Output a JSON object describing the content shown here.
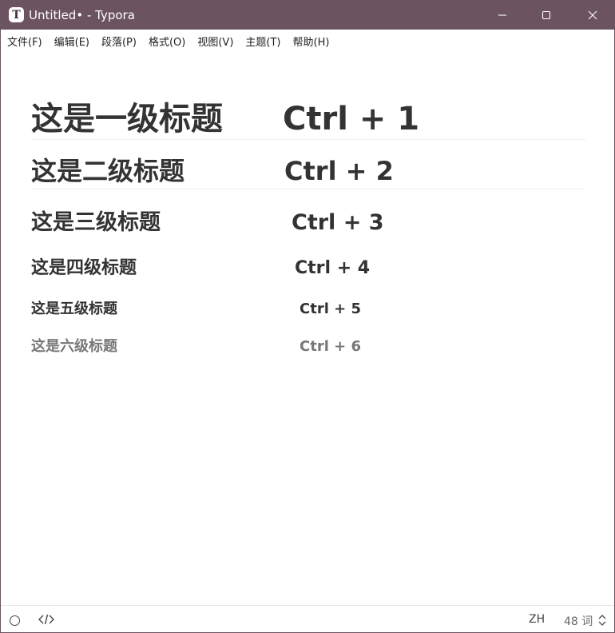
{
  "window": {
    "title": "Untitled• - Typora",
    "app_icon_letter": "T"
  },
  "menu": [
    {
      "label": "文件(F)"
    },
    {
      "label": "编辑(E)"
    },
    {
      "label": "段落(P)"
    },
    {
      "label": "格式(O)"
    },
    {
      "label": "视图(V)"
    },
    {
      "label": "主题(T)"
    },
    {
      "label": "帮助(H)"
    }
  ],
  "headings": [
    {
      "text": "这是一级标题",
      "shortcut": "Ctrl + 1"
    },
    {
      "text": "这是二级标题",
      "shortcut": "Ctrl + 2"
    },
    {
      "text": "这是三级标题",
      "shortcut": "Ctrl + 3"
    },
    {
      "text": "这是四级标题",
      "shortcut": "Ctrl + 4"
    },
    {
      "text": "这是五级标题",
      "shortcut": "Ctrl + 5"
    },
    {
      "text": "这是六级标题",
      "shortcut": "Ctrl + 6"
    }
  ],
  "status": {
    "lang": "ZH",
    "word_count": "48 词"
  },
  "icons": {
    "minimize": "minimize-icon",
    "maximize": "maximize-icon",
    "close": "close-icon",
    "outline": "circle-icon",
    "source": "code-icon",
    "word_toggle": "chevron-updown-icon"
  },
  "colors": {
    "titlebar": "#6b5360",
    "heading_text": "#333333",
    "h6_text": "#777777"
  }
}
